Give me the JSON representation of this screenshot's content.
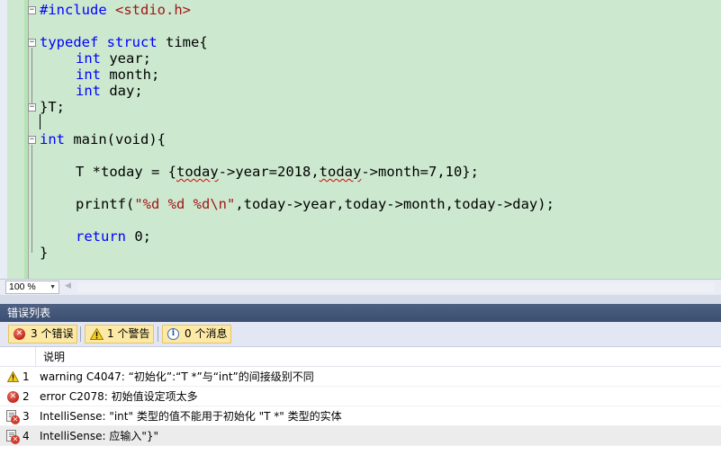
{
  "editor": {
    "zoom": "100 %",
    "lines": [
      [
        "#include ",
        "<stdio.h>"
      ],
      [
        "typedef struct",
        " time{"
      ],
      [
        "int",
        " year;"
      ],
      [
        "int",
        " month;"
      ],
      [
        "int",
        " day;"
      ],
      [
        "}T;"
      ],
      [
        "int",
        " main(void){"
      ],
      [
        "T *",
        "today",
        " = {",
        "today",
        "->year=2018,",
        "today",
        "->month=7,10};"
      ],
      [
        "printf(",
        "\"%d %d %d\\n\"",
        ",today->year,today->month,today->day);"
      ],
      [
        "return",
        " 0;"
      ],
      [
        "}"
      ]
    ]
  },
  "error_list": {
    "title": "错误列表",
    "filters": {
      "errors": "3 个错误",
      "warnings": "1 个警告",
      "messages": "0 个消息"
    },
    "column_header": "说明",
    "rows": [
      {
        "num": "1",
        "type": "warning",
        "text": "warning C4047: “初始化”:“T *”与“int”的间接级别不同"
      },
      {
        "num": "2",
        "type": "error",
        "text": "error C2078: 初始值设定项太多"
      },
      {
        "num": "3",
        "type": "intellisense",
        "text": "IntelliSense: \"int\" 类型的值不能用于初始化 \"T *\" 类型的实体"
      },
      {
        "num": "4",
        "type": "intellisense",
        "text": "IntelliSense: 应输入\"}\""
      }
    ]
  }
}
